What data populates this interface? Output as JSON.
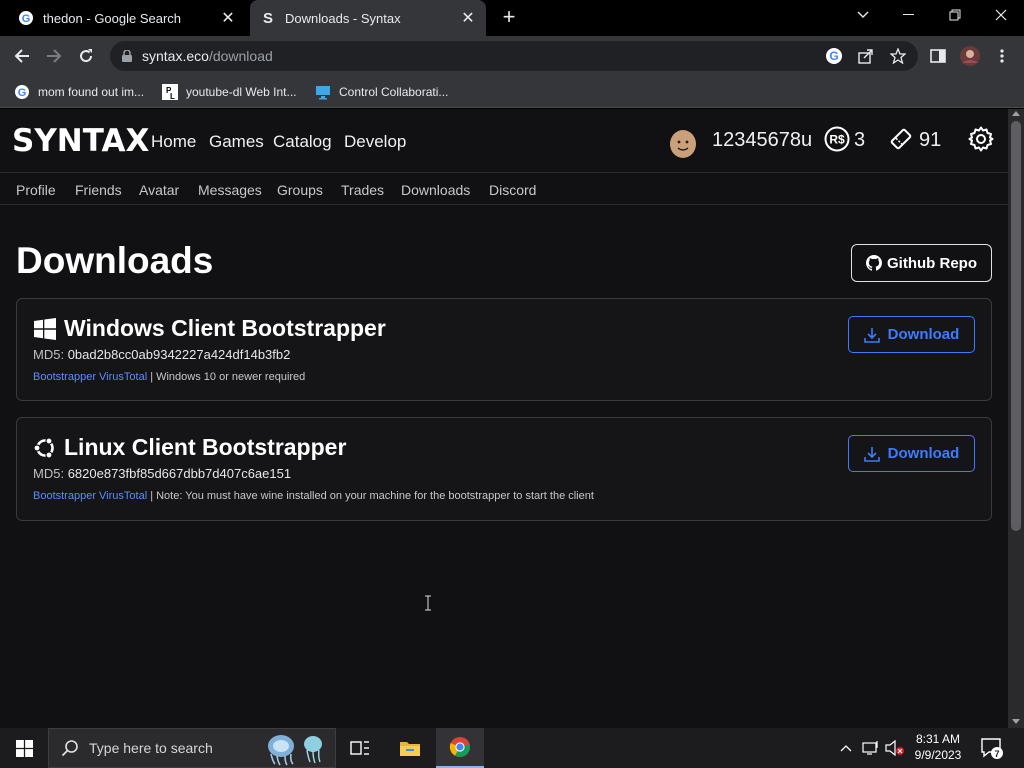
{
  "browser": {
    "tabs": [
      {
        "title": "thedon - Google Search",
        "favicon": "google-g-icon",
        "active": false
      },
      {
        "title": "Downloads - Syntax",
        "favicon": "syntax-s-icon",
        "active": true
      }
    ],
    "url_host": "syntax.eco",
    "url_path": "/download",
    "bookmarks": [
      {
        "label": "mom found out im...",
        "icon": "google-g-icon"
      },
      {
        "label": "youtube-dl Web Int...",
        "icon": "pl-icon"
      },
      {
        "label": "Control Collaborati...",
        "icon": "monitor-icon"
      }
    ]
  },
  "site": {
    "logo": "SYNTAX",
    "main_nav": [
      "Home",
      "Games",
      "Catalog",
      "Develop"
    ],
    "username": "12345678u",
    "robux": "3",
    "tickets": "91",
    "sub_nav": [
      "Profile",
      "Friends",
      "Avatar",
      "Messages",
      "Groups",
      "Trades",
      "Downloads",
      "Discord"
    ]
  },
  "downloads": {
    "title": "Downloads",
    "github_label": "Github Repo",
    "md5_label": "MD5:",
    "cards": [
      {
        "os_icon": "windows-icon",
        "title": "Windows Client Bootstrapper",
        "md5": "0bad2b8cc0ab9342227a424df14b3fb2",
        "link": "Bootstrapper VirusTotal",
        "note": " | Windows 10 or newer required",
        "button": "Download"
      },
      {
        "os_icon": "ubuntu-icon",
        "title": "Linux Client Bootstrapper",
        "md5": "6820e873fbf85d667dbb7d407c6ae151",
        "link": "Bootstrapper VirusTotal",
        "note": " | Note: You must have wine installed on your machine for the bootstrapper to start the client",
        "button": "Download"
      }
    ]
  },
  "taskbar": {
    "search_placeholder": "Type here to search",
    "time": "8:31 AM",
    "date": "9/9/2023",
    "notification_count": "7"
  },
  "colors": {
    "page_bg": "#111113",
    "accent_blue": "#3d7bff",
    "link_blue": "#5b8cff"
  }
}
